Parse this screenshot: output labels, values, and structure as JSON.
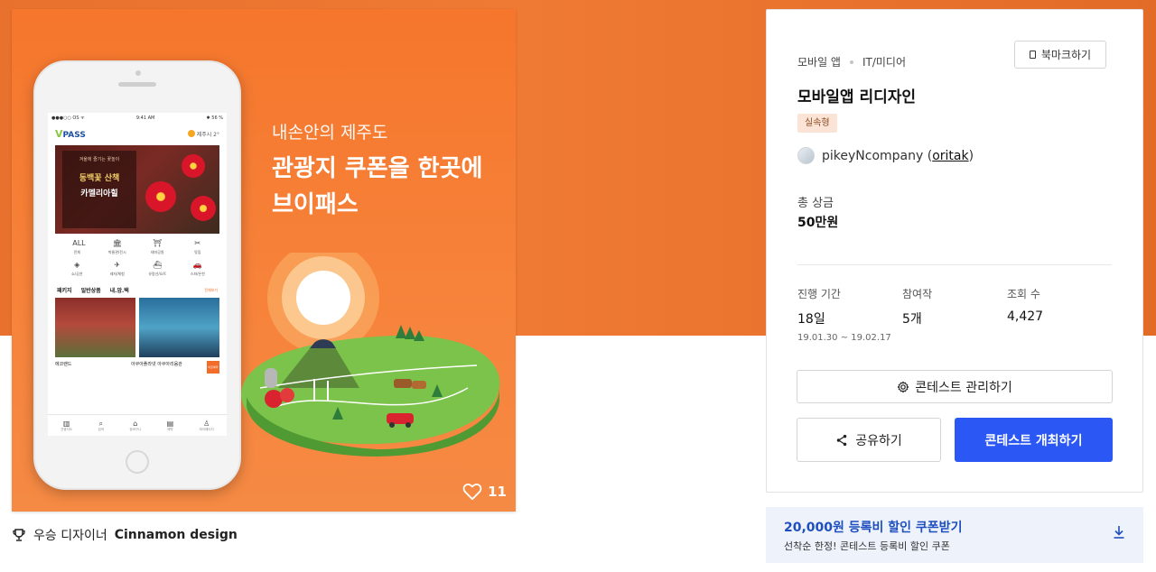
{
  "artwork": {
    "headline_sub": "내손안의 제주도",
    "headline_line1": "관광지 쿠폰을 한곳에",
    "headline_line2": "브이패스",
    "likes": "11",
    "phone": {
      "status_left": "●●●○○ OS ᯤ",
      "status_time": "9:41 AM",
      "status_right": "✱ 56 %",
      "logo_v": "V",
      "logo_rest": "PASS",
      "weather": "제주시 2°",
      "banner_sub": "겨울에 즐기는 꽃놀이",
      "banner_title1": "동백꽃 산책",
      "banner_title2": "카멜리아힐",
      "categories": [
        {
          "icon": "ALL",
          "label": "전체"
        },
        {
          "icon": "🏛",
          "label": "박물관/전시"
        },
        {
          "icon": "⛩",
          "label": "테마공원"
        },
        {
          "icon": "✂",
          "label": "맛집"
        },
        {
          "icon": "◈",
          "label": "쇼/공연"
        },
        {
          "icon": "✈",
          "label": "레저/체험"
        },
        {
          "icon": "⛴",
          "label": "유람선/요트"
        },
        {
          "icon": "🚗",
          "label": "스파/온천"
        }
      ],
      "tabs": [
        "패키지",
        "일반상품",
        "내.암.택"
      ],
      "tabs_more": "전체보기",
      "thumb_label1": "에코랜드",
      "thumb_label2": "아쿠아플라넷 아쿠아리움관",
      "tag_btn": "바로예약",
      "nav": [
        {
          "icon": "▥",
          "label": "관광지도"
        },
        {
          "icon": "⌕",
          "label": "검색"
        },
        {
          "icon": "⌂",
          "label": "장바구니"
        },
        {
          "icon": "▤",
          "label": "예약"
        },
        {
          "icon": "♙",
          "label": "마이페이지"
        }
      ]
    }
  },
  "winner": {
    "label": "우승 디자이너",
    "name": "Cinnamon design"
  },
  "contest": {
    "crumb_category": "모바일 앱",
    "crumb_subcategory": "IT/미디어",
    "bookmark_label": "북마크하기",
    "title": "모바일앱 리디자인",
    "badge": "실속형",
    "host_name": "pikeyNcompany",
    "host_id": "oritak",
    "prize_label": "총 상금",
    "prize_value": "50만원",
    "stats": [
      {
        "label": "진행 기간",
        "value": "18일",
        "sub": "19.01.30 ~ 19.02.17"
      },
      {
        "label": "참여작",
        "value": "5개",
        "sub": ""
      },
      {
        "label": "조회 수",
        "value": "4,427",
        "sub": ""
      }
    ],
    "manage_label": "콘테스트 관리하기",
    "share_label": "공유하기",
    "host_button_label": "콘테스트 개최하기"
  },
  "coupon": {
    "title": "20,000원 등록비 할인 쿠폰받기",
    "desc": "선착순 한정! 콘테스트 등록비 할인 쿠폰"
  },
  "colors": {
    "hero_orange": "#e8712e",
    "primary_blue": "#2b57f5",
    "coupon_blue": "#1f4fbf",
    "badge_bg": "#fbe4d6"
  }
}
